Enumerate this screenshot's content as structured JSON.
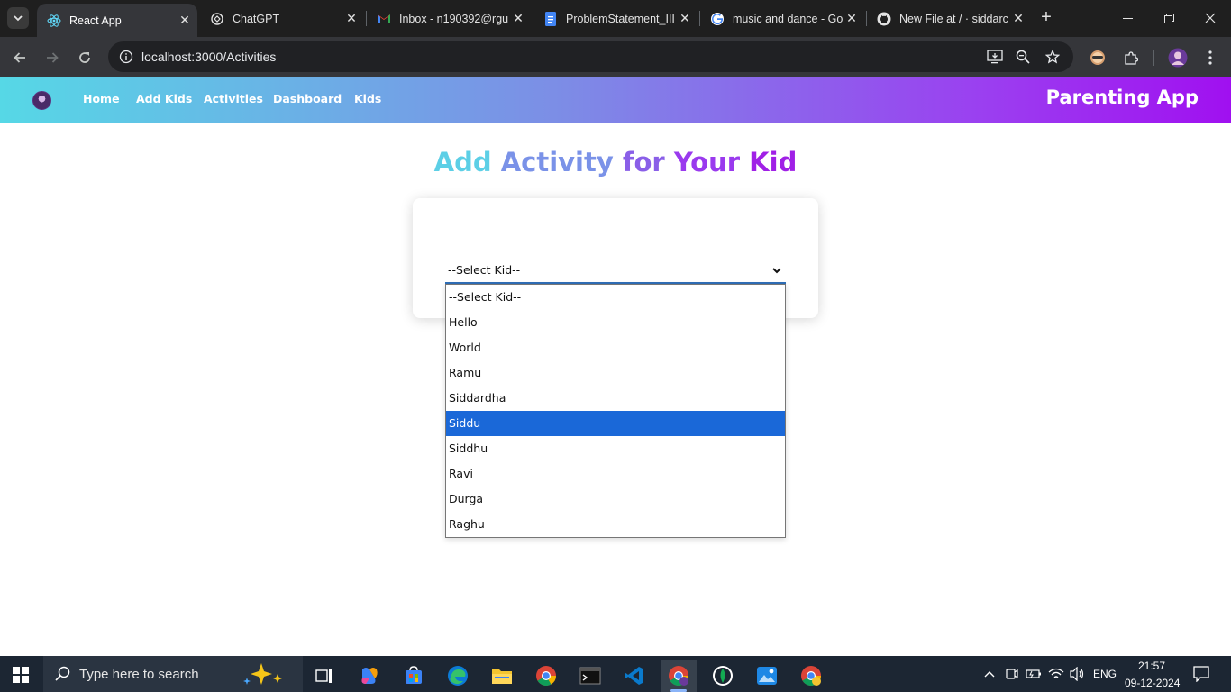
{
  "browser": {
    "tabs": [
      {
        "title": "React App",
        "icon": "react-icon",
        "active": true
      },
      {
        "title": "ChatGPT",
        "icon": "chatgpt-icon",
        "active": false
      },
      {
        "title": "Inbox - n190392@rgu",
        "icon": "gmail-icon",
        "active": false
      },
      {
        "title": "ProblemStatement_III",
        "icon": "docs-icon",
        "active": false
      },
      {
        "title": "music and dance - Go",
        "icon": "google-icon",
        "active": false
      },
      {
        "title": "New File at / · siddarc",
        "icon": "github-icon",
        "active": false
      }
    ],
    "url": "localhost:3000/Activities"
  },
  "app": {
    "nav": {
      "links": [
        "Home",
        "Add Kids",
        "Activities",
        "Dashboard",
        "Kids"
      ],
      "brand": "Parenting App"
    },
    "title_words": [
      "Add",
      "Activity",
      "for",
      "Your",
      "Kid"
    ],
    "select": {
      "value": "--Select Kid--",
      "options": [
        "--Select Kid--",
        "Hello",
        "World",
        "Ramu",
        "Siddardha",
        "Siddu",
        "Siddhu",
        "Ravi",
        "Durga",
        "Raghu"
      ],
      "highlighted": "Siddu"
    },
    "colors": {
      "gradient_start": "#56d8e6",
      "gradient_end": "#a010f0",
      "highlight": "#1a68d8"
    }
  },
  "taskbar": {
    "search_placeholder": "Type here to search",
    "language": "ENG",
    "time": "21:57",
    "date": "09-12-2024",
    "apps": [
      "task-view-icon",
      "copilot-icon",
      "store-icon",
      "edge-icon",
      "file-explorer-icon",
      "chrome-icon",
      "terminal-icon",
      "vscode-icon",
      "chrome-profile-icon",
      "mongodb-compass-icon",
      "photos-icon",
      "chrome-canary-icon"
    ]
  }
}
